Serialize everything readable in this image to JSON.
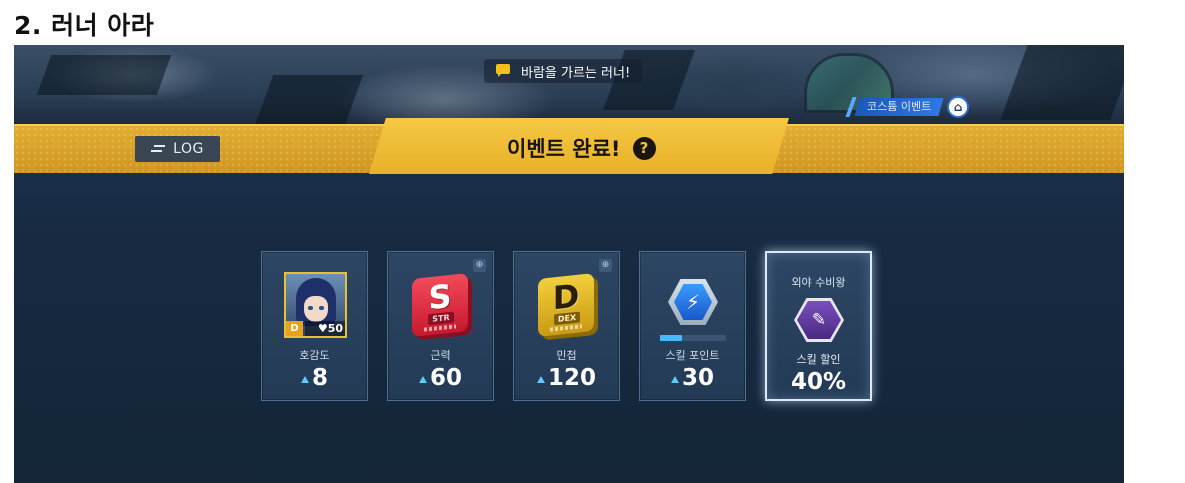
{
  "heading": "2. 러너 아라",
  "quest": {
    "text": "바람을 가르는 러너!",
    "icon": "chat-icon"
  },
  "costume_event": {
    "label": "코스튬 이벤트",
    "icon": "hanger-icon",
    "icon_glyph": "⌂"
  },
  "log_button": {
    "label": "LOG",
    "icon": "log-icon"
  },
  "event": {
    "title": "이벤트 완료!",
    "help_glyph": "?"
  },
  "cards": [
    {
      "label": "호감도",
      "value": "8",
      "portrait_grade": "D",
      "portrait_level": "♥50"
    },
    {
      "label": "근력",
      "value": "60",
      "gem_letter": "S",
      "gem_tag": "STR"
    },
    {
      "label": "민첩",
      "value": "120",
      "gem_letter": "D",
      "gem_tag": "DEX"
    },
    {
      "label": "스킬 포인트",
      "value": "30",
      "skill_progress": 0.33
    },
    {
      "label": "스킬 할인",
      "value": "40%",
      "top_label": "외야 수비왕",
      "badge_glyph": "✎"
    }
  ],
  "colors": {
    "gold": "#e2ad2f",
    "accent_blue": "#5ec8ff",
    "str_red": "#d8203a",
    "dex_gold": "#e2b423"
  }
}
